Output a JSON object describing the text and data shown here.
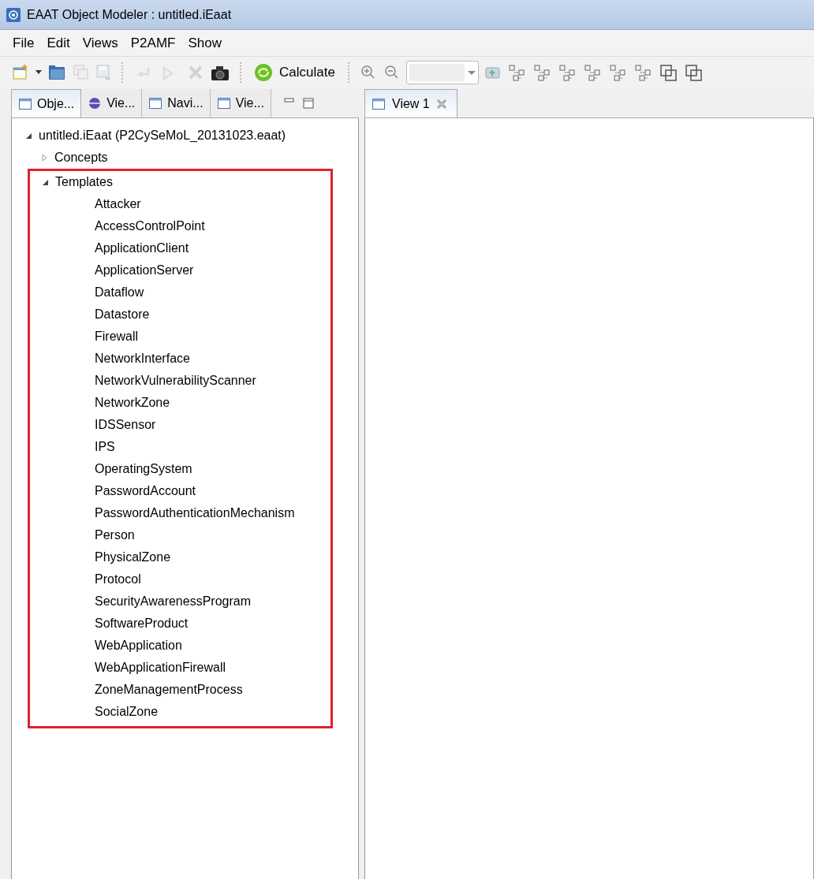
{
  "window": {
    "title": "EAAT Object Modeler : untitled.iEaat"
  },
  "menu": [
    "File",
    "Edit",
    "Views",
    "P2AMF",
    "Show"
  ],
  "toolbar": [
    {
      "kind": "new",
      "disabled": false
    },
    {
      "kind": "dropdown",
      "disabled": false
    },
    {
      "kind": "open",
      "disabled": false
    },
    {
      "kind": "saveall",
      "disabled": true
    },
    {
      "kind": "saveas",
      "disabled": true
    },
    {
      "kind": "sep"
    },
    {
      "kind": "undo",
      "disabled": true
    },
    {
      "kind": "redo",
      "disabled": true
    },
    {
      "kind": "delete",
      "disabled": true
    },
    {
      "kind": "camera",
      "disabled": false
    },
    {
      "kind": "sep"
    },
    {
      "kind": "calculate",
      "label": "Calculate",
      "disabled": false
    },
    {
      "kind": "sep"
    },
    {
      "kind": "zoomin",
      "disabled": false
    },
    {
      "kind": "zoomout",
      "disabled": false
    },
    {
      "kind": "combo",
      "disabled": true
    },
    {
      "kind": "folderup",
      "disabled": false
    },
    {
      "kind": "layout",
      "disabled": false
    },
    {
      "kind": "layout",
      "disabled": false
    },
    {
      "kind": "layout",
      "disabled": false
    },
    {
      "kind": "layout",
      "disabled": false
    },
    {
      "kind": "layout",
      "disabled": false
    },
    {
      "kind": "layout",
      "disabled": false
    },
    {
      "kind": "stack",
      "disabled": false
    },
    {
      "kind": "stack",
      "disabled": false
    }
  ],
  "left_tabs": [
    {
      "label": "Obje...",
      "kind": "window",
      "selected": true
    },
    {
      "label": "Vie...",
      "kind": "globe",
      "selected": false
    },
    {
      "label": "Navi...",
      "kind": "window",
      "selected": false
    },
    {
      "label": "Vie...",
      "kind": "window",
      "selected": false
    }
  ],
  "right_tabs": [
    {
      "label": "View 1",
      "selected": true
    }
  ],
  "tree": [
    {
      "label": "untitled.iEaat (P2CySeMoL_20131023.eaat)",
      "expanded": true,
      "children": [
        {
          "label": "Concepts",
          "expanded": false
        },
        {
          "label": "Templates",
          "expanded": true,
          "highlighted": true,
          "children": [
            {
              "label": "Attacker"
            },
            {
              "label": "AccessControlPoint"
            },
            {
              "label": "ApplicationClient"
            },
            {
              "label": "ApplicationServer"
            },
            {
              "label": "Dataflow"
            },
            {
              "label": "Datastore"
            },
            {
              "label": "Firewall"
            },
            {
              "label": "NetworkInterface"
            },
            {
              "label": "NetworkVulnerabilityScanner"
            },
            {
              "label": "NetworkZone"
            },
            {
              "label": "IDSSensor"
            },
            {
              "label": "IPS"
            },
            {
              "label": "OperatingSystem"
            },
            {
              "label": "PasswordAccount"
            },
            {
              "label": "PasswordAuthenticationMechanism"
            },
            {
              "label": "Person"
            },
            {
              "label": "PhysicalZone"
            },
            {
              "label": "Protocol"
            },
            {
              "label": "SecurityAwarenessProgram"
            },
            {
              "label": "SoftwareProduct"
            },
            {
              "label": "WebApplication"
            },
            {
              "label": "WebApplicationFirewall"
            },
            {
              "label": "ZoneManagementProcess"
            },
            {
              "label": "SocialZone"
            }
          ]
        }
      ]
    }
  ]
}
